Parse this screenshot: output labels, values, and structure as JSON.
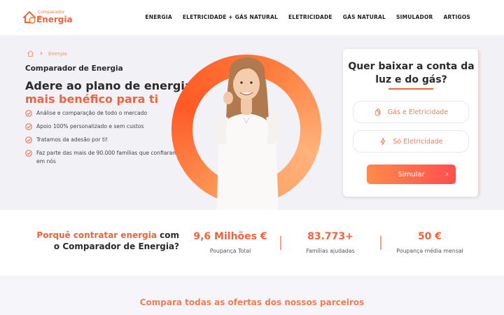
{
  "logo": {
    "small_text": "Comparador de",
    "big_text": "Energia",
    "icon": "house-plug-icon"
  },
  "nav": [
    "ENERGIA",
    "ELETRICIDADE + GÁS NATURAL",
    "ELETRICIDADE",
    "GÁS NATURAL",
    "SIMULADOR",
    "ARTIGOS"
  ],
  "breadcrumb": {
    "home_icon": "home-icon",
    "current": "Energia"
  },
  "hero": {
    "subtitle": "Comparador de Energia",
    "title_line1": "Adere ao plano de energia",
    "title_line2": "mais benéfico para ti",
    "features": [
      "Análise e comparação de todo o mercado",
      "Apoio 100% personalizado e sem custos",
      "Tratamos da adesão por ti!",
      "Faz parte das mais de 90.000 famílias que confiaram em nós"
    ]
  },
  "card": {
    "title": "Quer baixar a conta da luz e do gás?",
    "option_gas_elec": "Gás e Eletricidade",
    "option_elec": "Só Eletricidade",
    "button": "Simular"
  },
  "stats": {
    "why_prefix": "Porquê contratar energia",
    "why_suffix": "com o Comparador de Energia?",
    "items": [
      {
        "value": "9,6 Milhões €",
        "label": "Poupança Total"
      },
      {
        "value": "83.773+",
        "label": "Famílias ajudadas"
      },
      {
        "value": "50 €",
        "label": "Poupança média mensal"
      }
    ]
  },
  "partners_title": "Compara todas as ofertas dos nossos parceiros",
  "colors": {
    "accent": "#f0643c",
    "hero_bg": "#f1f1f6"
  }
}
